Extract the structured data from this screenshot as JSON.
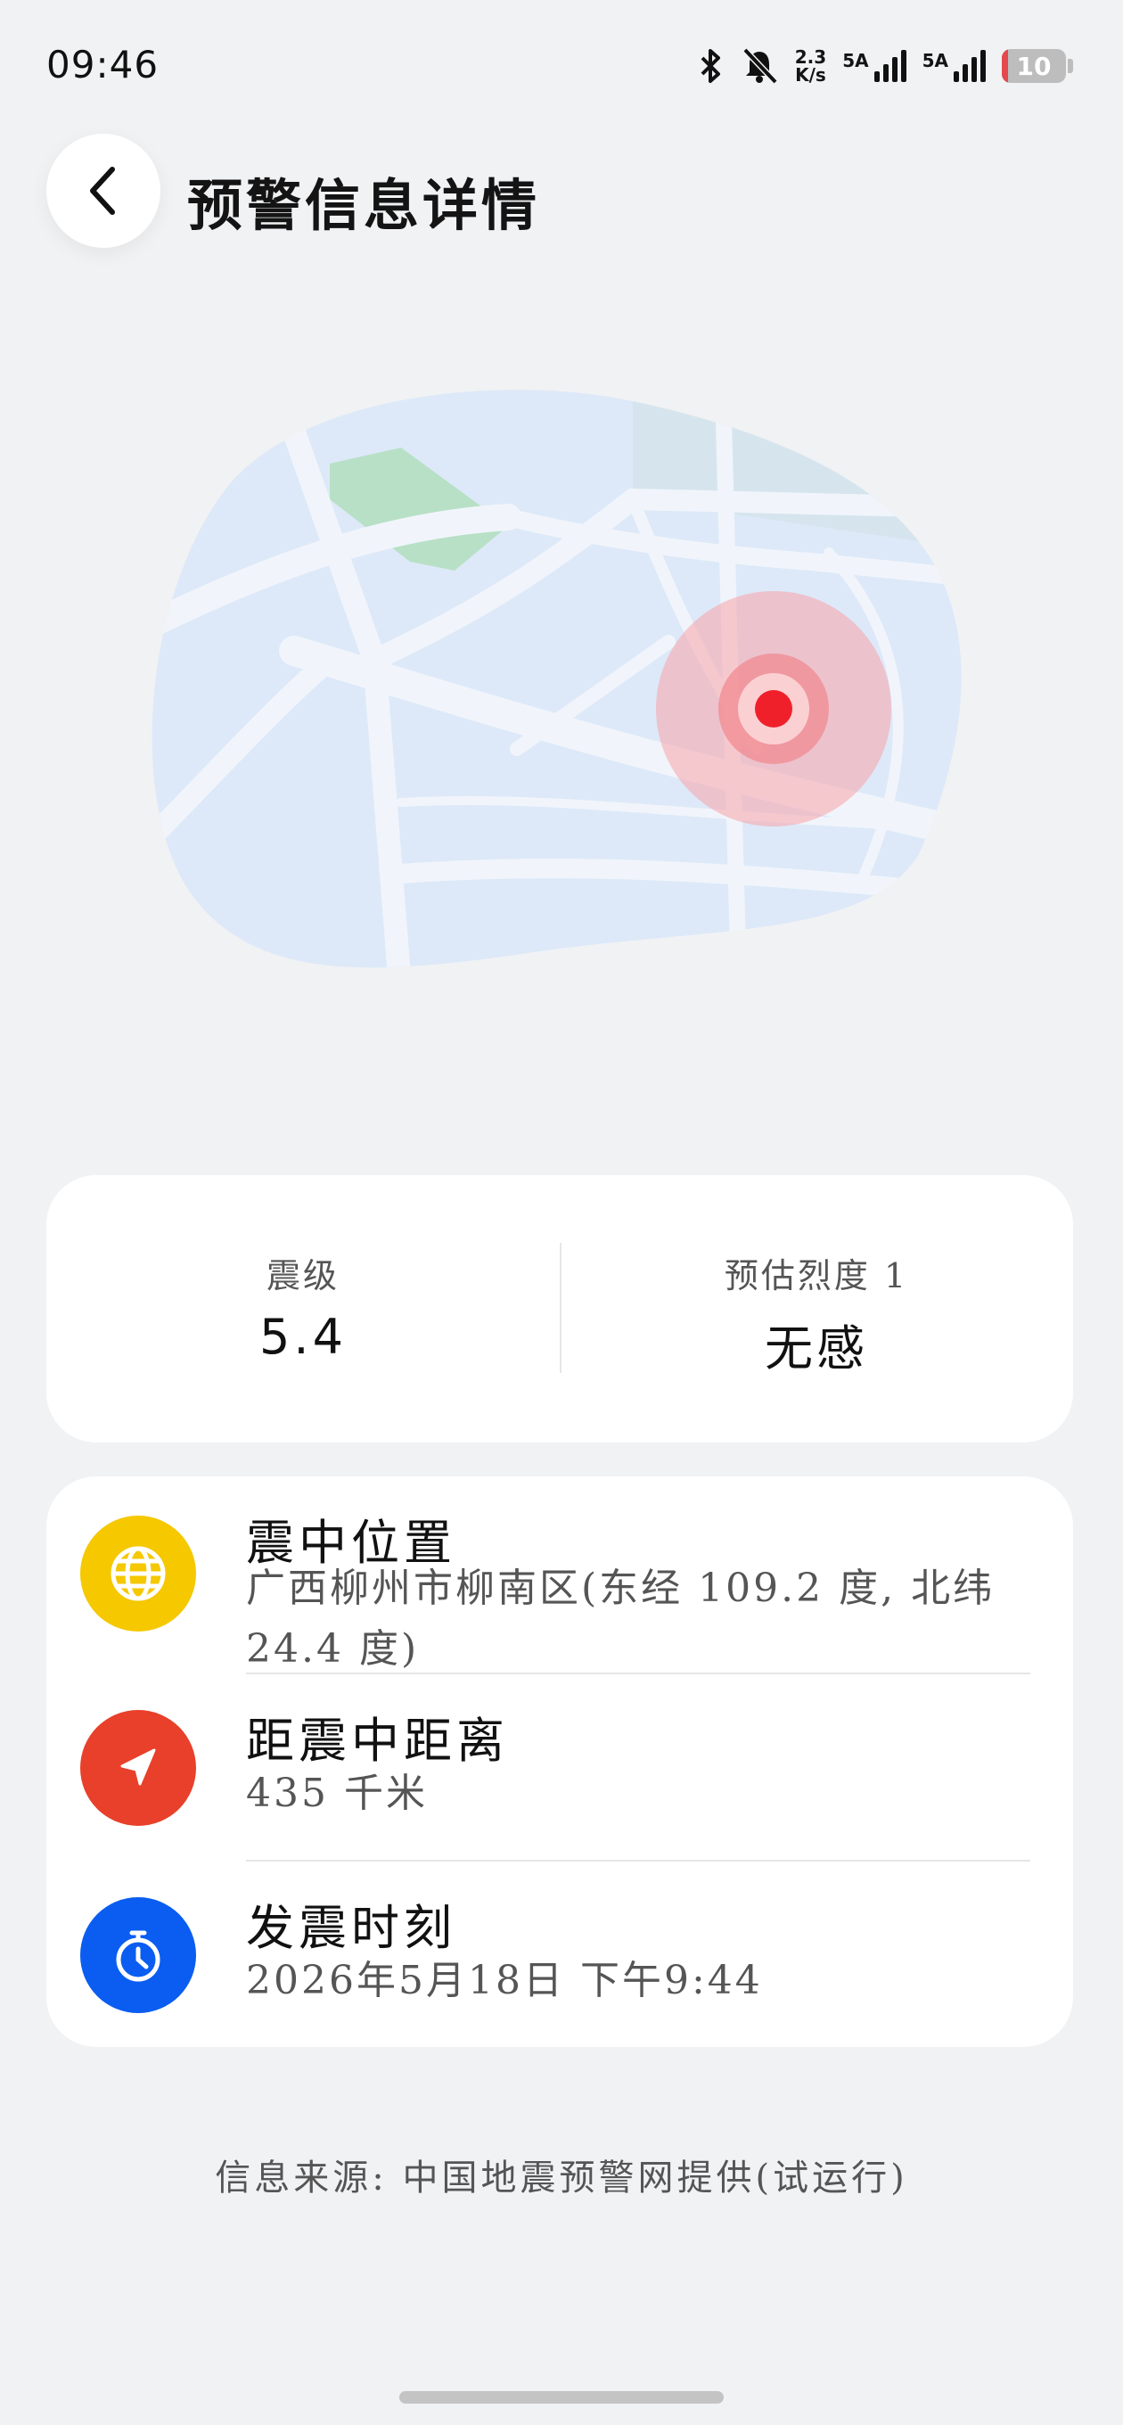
{
  "status_bar": {
    "time": "09:46",
    "net_speed_value": "2.3",
    "net_speed_unit": "K/s",
    "sim1_label": "5A",
    "sim2_label": "5A",
    "battery_level": "10",
    "battery_fraction": 0.1,
    "icons": [
      "bluetooth-icon",
      "bell-muted-icon",
      "signal-icon",
      "battery-icon"
    ]
  },
  "header": {
    "title": "预警信息详情"
  },
  "magnitude_card": {
    "magnitude_label": "震级",
    "magnitude_value": "5.4",
    "intensity_label": "预估烈度 1",
    "intensity_value": "无感"
  },
  "info_rows": [
    {
      "icon": "globe-icon",
      "icon_color": "#f5c800",
      "title": "震中位置",
      "value": "广西柳州市柳南区(东经 109.2 度, 北纬 24.4 度)"
    },
    {
      "icon": "navigation-arrow-icon",
      "icon_color": "#e8402a",
      "title": "距震中距离",
      "value": "435 千米"
    },
    {
      "icon": "stopwatch-icon",
      "icon_color": "#0a5df0",
      "title": "发震时刻",
      "value": "2026年5月18日 下午9:44"
    }
  ],
  "footer": {
    "source": "信息来源: 中国地震预警网提供(试运行)"
  },
  "colors": {
    "background": "#f1f2f4",
    "card": "#ffffff",
    "epicenter": "#f0202a",
    "map_fill": "#dde9f8"
  }
}
